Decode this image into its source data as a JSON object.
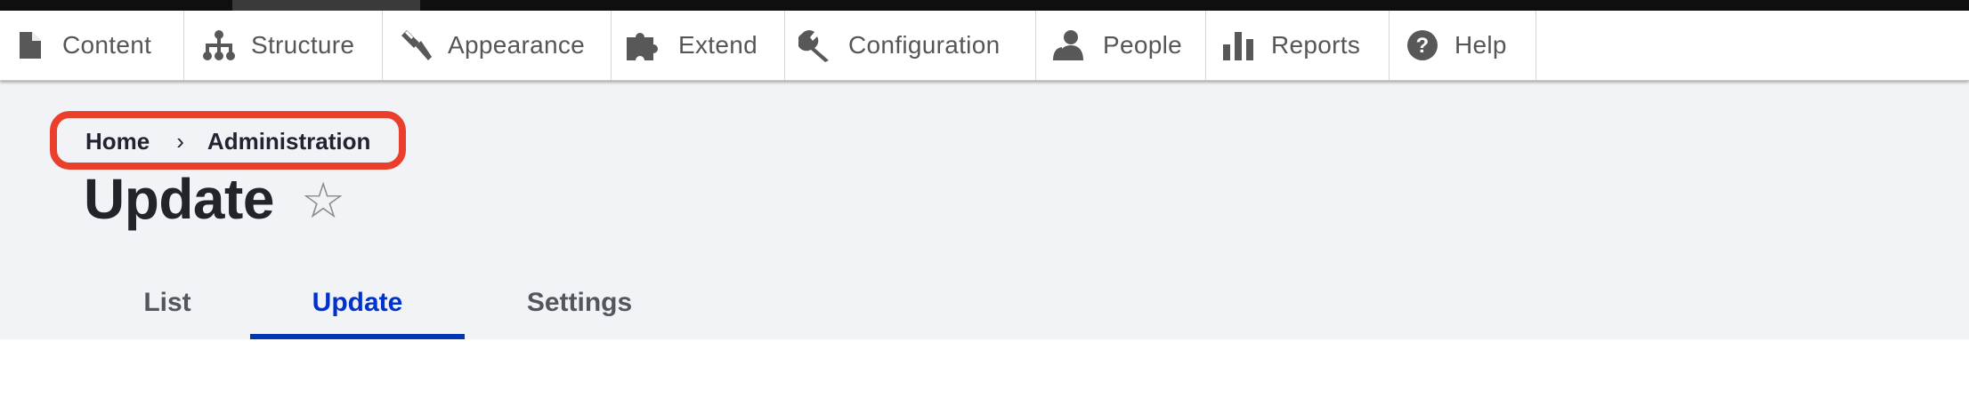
{
  "toolbar": {
    "items": [
      {
        "label": "Content",
        "icon": "file-icon"
      },
      {
        "label": "Structure",
        "icon": "sitemap-icon"
      },
      {
        "label": "Appearance",
        "icon": "paint-brush-icon"
      },
      {
        "label": "Extend",
        "icon": "puzzle-icon"
      },
      {
        "label": "Configuration",
        "icon": "wrench-icon"
      },
      {
        "label": "People",
        "icon": "person-icon"
      },
      {
        "label": "Reports",
        "icon": "bar-chart-icon"
      },
      {
        "label": "Help",
        "icon": "question-circle-icon"
      }
    ]
  },
  "breadcrumb": {
    "items": [
      "Home",
      "Administration"
    ],
    "separator": "›"
  },
  "page": {
    "title": "Update",
    "favorite_icon": "☆"
  },
  "tabs": [
    {
      "label": "List",
      "active": false
    },
    {
      "label": "Update",
      "active": true
    },
    {
      "label": "Settings",
      "active": false
    }
  ],
  "colors": {
    "highlight": "#ea3f2a",
    "active_tab": "#0033cc",
    "header_bg": "#f2f3f7"
  }
}
